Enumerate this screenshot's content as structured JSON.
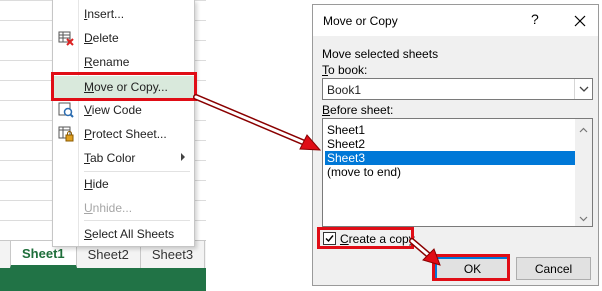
{
  "context_menu": {
    "items": [
      {
        "label": "Insert...",
        "ul": "I",
        "rest": "nsert...",
        "icon": "none",
        "disabled": false
      },
      {
        "label": "Delete",
        "ul": "D",
        "rest": "elete",
        "icon": "delete-sheet-icon",
        "disabled": false
      },
      {
        "label": "Rename",
        "ul": "R",
        "rest": "ename",
        "icon": "none",
        "disabled": false
      },
      {
        "label": "Move or Copy...",
        "ul": "M",
        "rest": "ove or Copy...",
        "icon": "none",
        "disabled": false
      },
      {
        "label": "View Code",
        "ul": "V",
        "rest": "iew Code",
        "icon": "view-code-icon",
        "disabled": false
      },
      {
        "label": "Protect Sheet...",
        "ul": "P",
        "rest": "rotect Sheet...",
        "icon": "protect-sheet-icon",
        "disabled": false
      },
      {
        "label": "Tab Color",
        "ul": "T",
        "rest": "ab Color",
        "icon": "none",
        "disabled": false
      },
      {
        "label": "Hide",
        "ul": "H",
        "rest": "ide",
        "icon": "none",
        "disabled": false
      },
      {
        "label": "Unhide...",
        "ul": "U",
        "rest": "nhide...",
        "icon": "none",
        "disabled": true
      },
      {
        "label": "Select All Sheets",
        "ul": "S",
        "rest": "elect All Sheets",
        "icon": "none",
        "disabled": false
      }
    ]
  },
  "sheet_tabs": [
    "Sheet1",
    "Sheet2",
    "Sheet3"
  ],
  "active_tab": "Sheet1",
  "dialog": {
    "title": "Move or Copy",
    "help": "?",
    "move_selected_label": "Move selected sheets",
    "to_book_ul": "T",
    "to_book_rest": "o book:",
    "to_book_value": "Book1",
    "before_sheet_ul": "B",
    "before_sheet_rest": "efore sheet:",
    "before_sheet_options": [
      "Sheet1",
      "Sheet2",
      "Sheet3",
      "(move to end)"
    ],
    "selected_option": "Sheet3",
    "create_copy_ul": "C",
    "create_copy_rest": "reate a copy",
    "create_copy_checked": true,
    "ok_label": "OK",
    "cancel_label": "Cancel"
  },
  "colors": {
    "highlight_red": "#e00d16",
    "excel_green": "#217346",
    "selection_blue": "#0078d7",
    "menu_hover_green": "#d9e9dc"
  }
}
